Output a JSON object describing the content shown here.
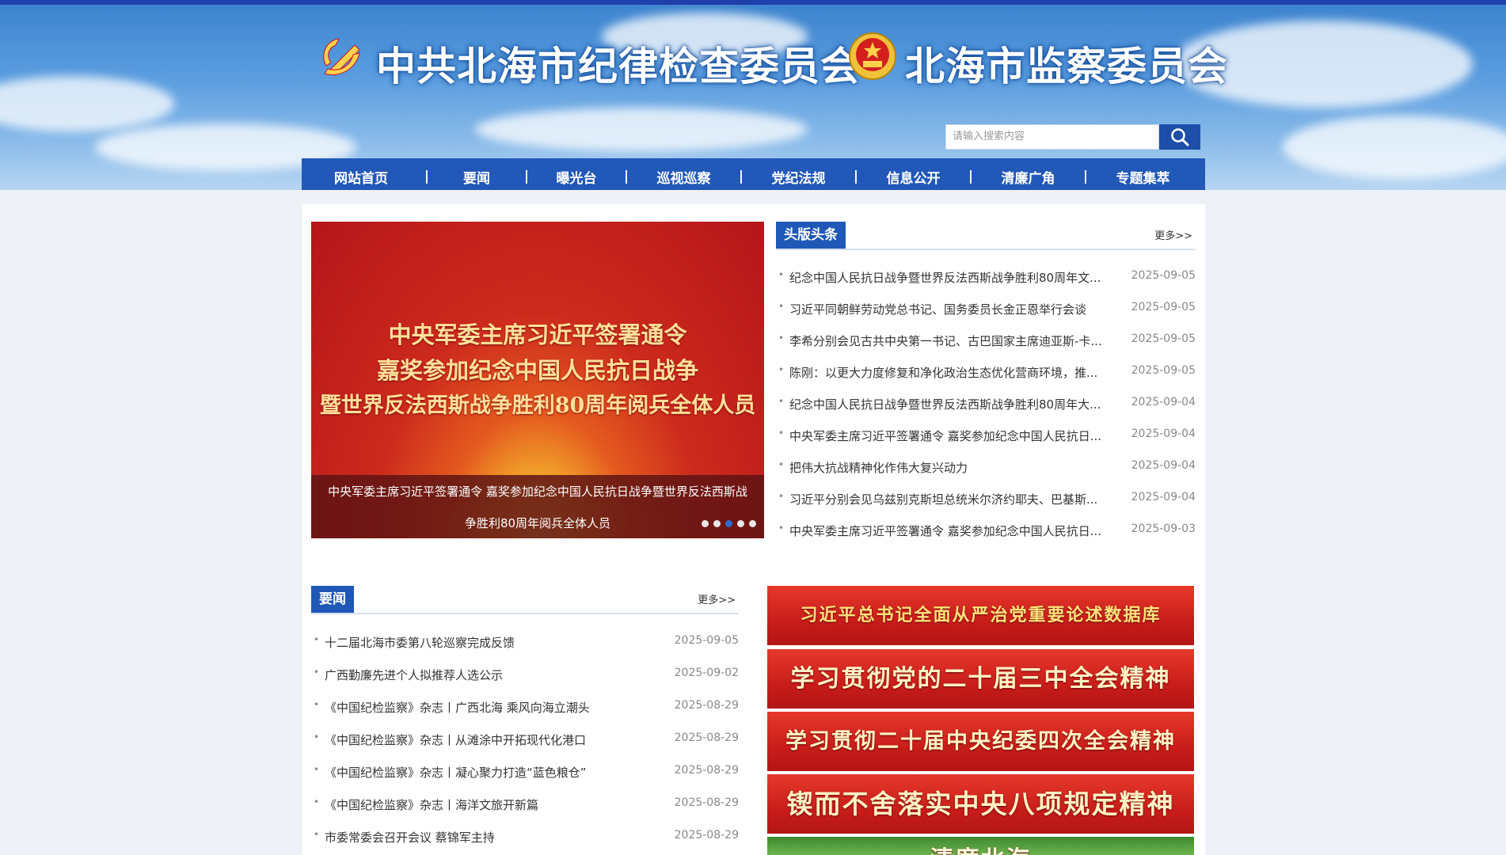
{
  "header": {
    "title_left": "中共北海市纪律检查委员会",
    "title_right": "北海市监察委员会",
    "search_placeholder": "请输入搜索内容"
  },
  "nav": {
    "items": [
      "网站首页",
      "要闻",
      "曝光台",
      "巡视巡察",
      "党纪法规",
      "信息公开",
      "清廉广角",
      "专题集萃"
    ],
    "separator": "|"
  },
  "slider": {
    "headline_lines": [
      "中央军委主席习近平签署通令",
      "嘉奖参加纪念中国人民抗日战争",
      "暨世界反法西斯战争胜利80周年阅兵全体人员"
    ],
    "caption_line1": "中央军委主席习近平签署通令 嘉奖参加纪念中国人民抗日战争暨世界反法西斯战",
    "caption_line2": "争胜利80周年阅兵全体人员",
    "dot_count": 5,
    "active_dot": 3
  },
  "headlines": {
    "label": "头版头条",
    "more": "更多>>",
    "items": [
      {
        "title": "纪念中国人民抗日战争暨世界反法西斯战争胜利80周年文...",
        "date": "2025-09-05"
      },
      {
        "title": "习近平同朝鲜劳动党总书记、国务委员长金正恩举行会谈",
        "date": "2025-09-05"
      },
      {
        "title": "李希分别会见古共中央第一书记、古巴国家主席迪亚斯-卡...",
        "date": "2025-09-05"
      },
      {
        "title": "陈刚：以更大力度修复和净化政治生态优化营商环境，推...",
        "date": "2025-09-05"
      },
      {
        "title": "纪念中国人民抗日战争暨世界反法西斯战争胜利80周年大...",
        "date": "2025-09-04"
      },
      {
        "title": "中央军委主席习近平签署通令 嘉奖参加纪念中国人民抗日...",
        "date": "2025-09-04"
      },
      {
        "title": "把伟大抗战精神化作伟大复兴动力",
        "date": "2025-09-04"
      },
      {
        "title": "习近平分别会见乌兹别克斯坦总统米尔济约耶夫、巴基斯...",
        "date": "2025-09-04"
      },
      {
        "title": "中央军委主席习近平签署通令 嘉奖参加纪念中国人民抗日...",
        "date": "2025-09-03"
      }
    ]
  },
  "news": {
    "label": "要闻",
    "more": "更多>>",
    "items": [
      {
        "title": "十二届北海市委第八轮巡察完成反馈",
        "date": "2025-09-05"
      },
      {
        "title": "广西勤廉先进个人拟推荐人选公示",
        "date": "2025-09-02"
      },
      {
        "title": "《中国纪检监察》杂志丨广西北海 乘风向海立潮头",
        "date": "2025-08-29"
      },
      {
        "title": "《中国纪检监察》杂志丨从滩涂中开拓现代化港口",
        "date": "2025-08-29"
      },
      {
        "title": "《中国纪检监察》杂志丨凝心聚力打造“蓝色粮仓”",
        "date": "2025-08-29"
      },
      {
        "title": "《中国纪检监察》杂志丨海洋文旅开新篇",
        "date": "2025-08-29"
      },
      {
        "title": "市委常委会召开会议 蔡锦军主持",
        "date": "2025-08-29"
      }
    ]
  },
  "banners": [
    "习近平总书记全面从严治党重要论述数据库",
    "学习贯彻党的二十届三中全会精神",
    "学习贯彻二十届中央纪委四次全会精神",
    "锲而不舍落实中央八项规定精神",
    "清廉北海"
  ],
  "colors": {
    "nav_bg": "#2258b8",
    "section_label_bg": "#1f58b6",
    "banner_red": "#c81d1a",
    "active_dot": "#2d6ad1"
  }
}
